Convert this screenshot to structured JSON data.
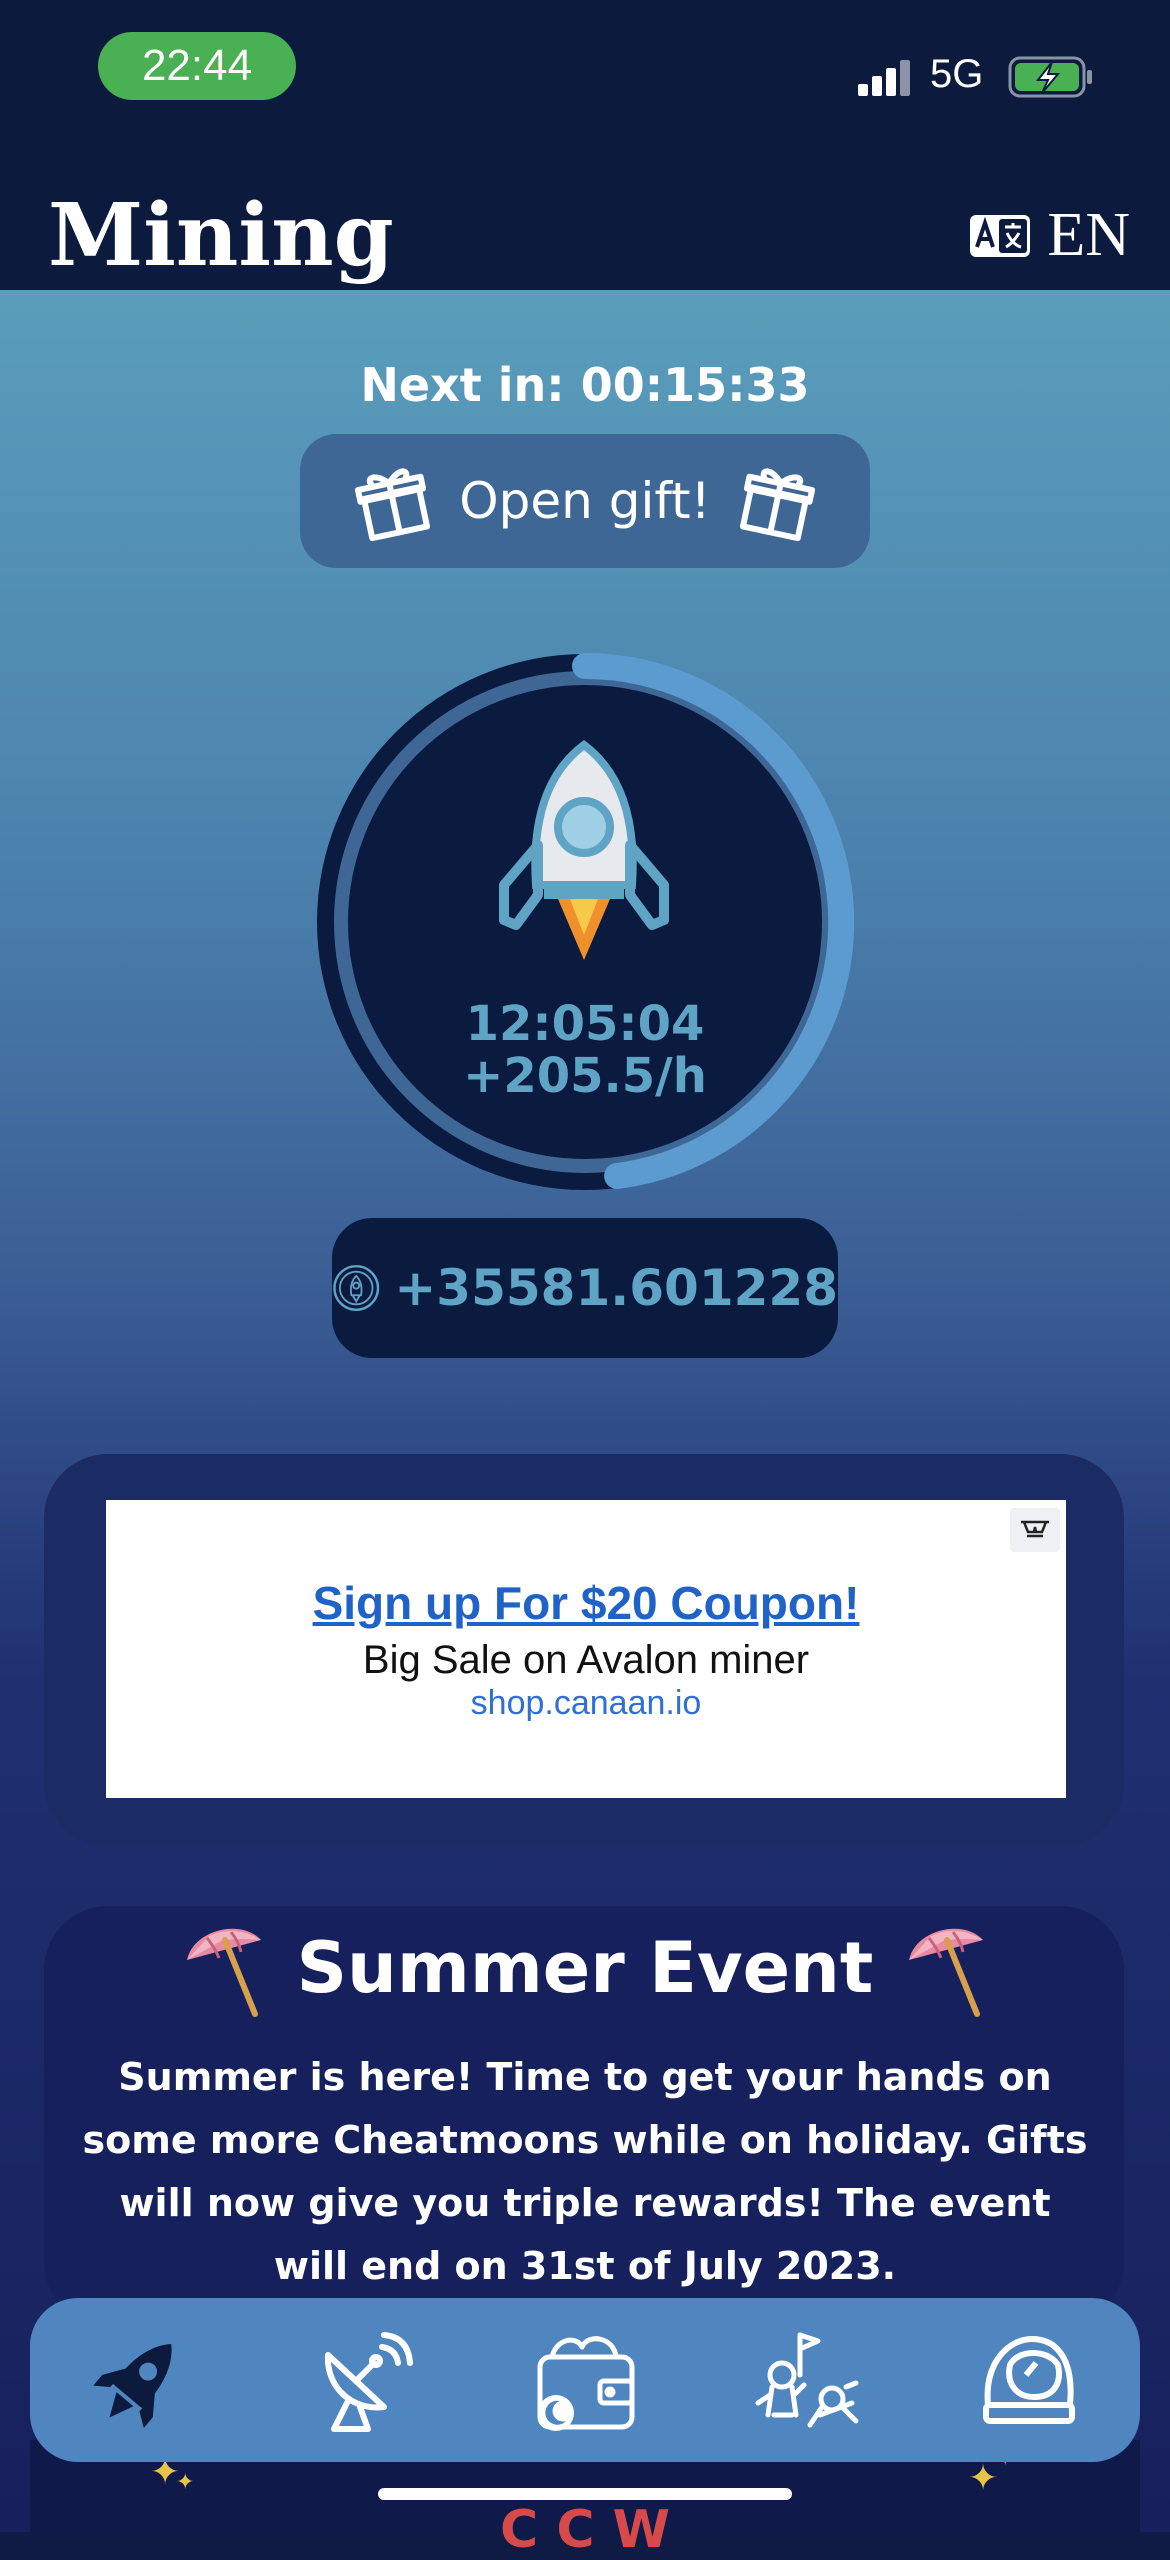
{
  "status_bar": {
    "time": "22:44",
    "network": "5G"
  },
  "app_bar": {
    "title": "Mining",
    "language": "EN"
  },
  "mining": {
    "next_in": "Next in: 00:15:33",
    "gift_button": "Open gift!",
    "progress": 0.48,
    "timer": "12:05:04",
    "rate": "+205.5/h",
    "balance": "+35581.601228"
  },
  "ad": {
    "headline": "Sign up For $20 Coupon!",
    "subline": "Big Sale on Avalon miner",
    "link": "shop.canaan.io"
  },
  "event": {
    "title": "Summer Event",
    "body": "Summer is here! Time to get your hands on some more Cheatmoons while on holiday. Gifts will now give you triple rewards! The event will end on 31st of July 2023."
  },
  "below_peek": "C  C  W",
  "tabs": [
    {
      "icon": "rocket-icon"
    },
    {
      "icon": "satellite-dish-icon"
    },
    {
      "icon": "wallet-icon"
    },
    {
      "icon": "astronauts-icon"
    },
    {
      "icon": "helmet-icon"
    }
  ],
  "colors": {
    "accent": "#5fa3c5",
    "navy": "#0c1a3d",
    "tabbar": "#4f86bf",
    "status_pill": "#4ab054"
  }
}
